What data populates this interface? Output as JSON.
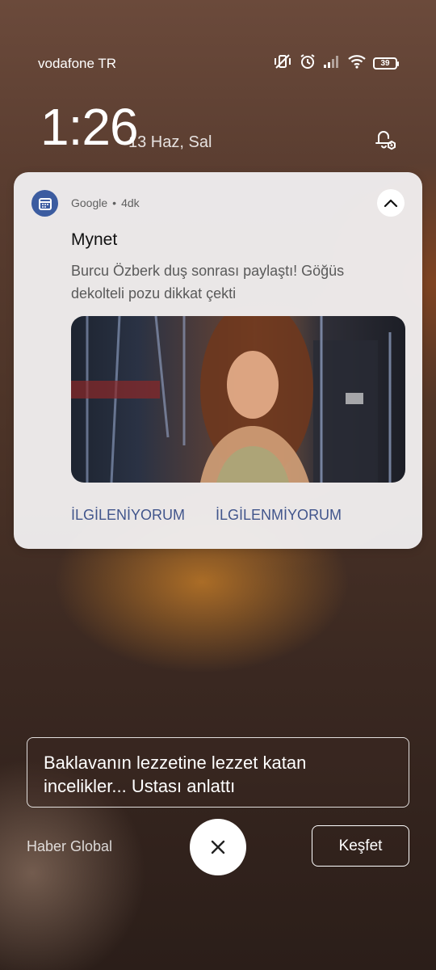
{
  "status_bar": {
    "carrier": "vodafone TR",
    "battery": "39",
    "icons": [
      "vibrate-off-icon",
      "alarm-icon",
      "signal-icon",
      "wifi-icon",
      "battery-icon"
    ]
  },
  "lockscreen": {
    "time": "1:26",
    "date": "13 Haz, Sal"
  },
  "notification": {
    "app_name": "Google",
    "separator": "•",
    "age": "4dk",
    "title": "Mynet",
    "body": "Burcu Özberk duş sonrası paylaştı! Göğüs dekolteli pozu dikkat çekti",
    "actions": [
      "İLGİLENİYORUM",
      "İLGİLENMİYORUM"
    ],
    "accent_color": "#41558c"
  },
  "wallpaper_story": {
    "headline": "Baklavanın lezzetine lezzet katan incelikler... Ustası anlattı",
    "source": "Haber Global",
    "explore_label": "Keşfet"
  }
}
